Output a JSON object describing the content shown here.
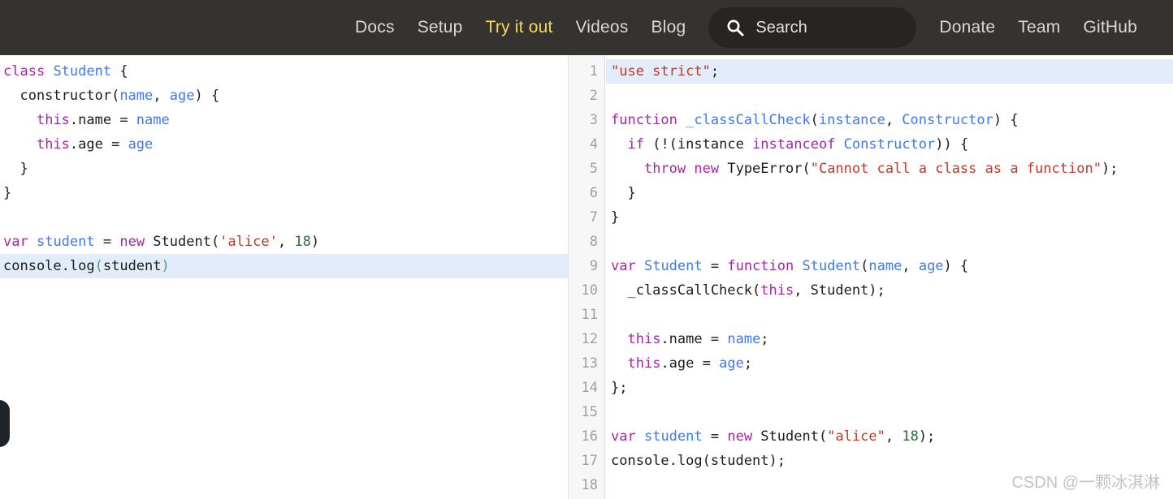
{
  "navbar": {
    "items": [
      {
        "label": "Docs",
        "active": false
      },
      {
        "label": "Setup",
        "active": false
      },
      {
        "label": "Try it out",
        "active": true
      },
      {
        "label": "Videos",
        "active": false
      },
      {
        "label": "Blog",
        "active": false
      }
    ],
    "right_items": [
      {
        "label": "Donate"
      },
      {
        "label": "Team"
      },
      {
        "label": "GitHub"
      }
    ],
    "search": {
      "placeholder": "Search",
      "icon": "search-icon"
    },
    "colors": {
      "background": "#34332f",
      "link": "#d8d8d4",
      "active_link": "#f5da55",
      "search_background": "#262523"
    }
  },
  "editor": {
    "input": {
      "active_line_index": 8,
      "lines": [
        {
          "tokens": [
            {
              "t": "class",
              "c": "t-kw"
            },
            {
              "t": " ",
              "c": "t-plain"
            },
            {
              "t": "Student",
              "c": "t-def"
            },
            {
              "t": " {",
              "c": "t-plain"
            }
          ]
        },
        {
          "tokens": [
            {
              "t": "  constructor",
              "c": "t-plain"
            },
            {
              "t": "(",
              "c": "t-plain"
            },
            {
              "t": "name",
              "c": "t-var"
            },
            {
              "t": ", ",
              "c": "t-plain"
            },
            {
              "t": "age",
              "c": "t-var"
            },
            {
              "t": ") {",
              "c": "t-plain"
            }
          ]
        },
        {
          "tokens": [
            {
              "t": "    ",
              "c": "t-plain"
            },
            {
              "t": "this",
              "c": "t-atom"
            },
            {
              "t": ".name = ",
              "c": "t-plain"
            },
            {
              "t": "name",
              "c": "t-var"
            }
          ]
        },
        {
          "tokens": [
            {
              "t": "    ",
              "c": "t-plain"
            },
            {
              "t": "this",
              "c": "t-atom"
            },
            {
              "t": ".age = ",
              "c": "t-plain"
            },
            {
              "t": "age",
              "c": "t-var"
            }
          ]
        },
        {
          "tokens": [
            {
              "t": "  }",
              "c": "t-plain"
            }
          ]
        },
        {
          "tokens": [
            {
              "t": "}",
              "c": "t-plain"
            }
          ]
        },
        {
          "tokens": [
            {
              "t": "",
              "c": "t-plain"
            }
          ]
        },
        {
          "tokens": [
            {
              "t": "var",
              "c": "t-kw"
            },
            {
              "t": " ",
              "c": "t-plain"
            },
            {
              "t": "student",
              "c": "t-def"
            },
            {
              "t": " = ",
              "c": "t-plain"
            },
            {
              "t": "new",
              "c": "t-kw"
            },
            {
              "t": " Student(",
              "c": "t-plain"
            },
            {
              "t": "'alice'",
              "c": "t-str"
            },
            {
              "t": ", ",
              "c": "t-plain"
            },
            {
              "t": "18",
              "c": "t-num"
            },
            {
              "t": ")",
              "c": "t-plain"
            }
          ]
        },
        {
          "tokens": [
            {
              "t": "console.",
              "c": "t-plain"
            },
            {
              "t": "log",
              "c": "t-plain"
            },
            {
              "t": "(",
              "c": "t-paren-g"
            },
            {
              "t": "student",
              "c": "t-plain"
            },
            {
              "t": ")",
              "c": "t-paren-g"
            }
          ]
        }
      ]
    },
    "output": {
      "active_line_index": 0,
      "line_numbers": [
        "1",
        "2",
        "3",
        "4",
        "5",
        "6",
        "7",
        "8",
        "9",
        "10",
        "11",
        "12",
        "13",
        "14",
        "15",
        "16",
        "17",
        "18"
      ],
      "lines": [
        {
          "tokens": [
            {
              "t": "\"use strict\"",
              "c": "t-str"
            },
            {
              "t": ";",
              "c": "t-plain"
            }
          ]
        },
        {
          "tokens": [
            {
              "t": "",
              "c": "t-plain"
            }
          ]
        },
        {
          "tokens": [
            {
              "t": "function",
              "c": "t-kw"
            },
            {
              "t": " ",
              "c": "t-plain"
            },
            {
              "t": "_classCallCheck",
              "c": "t-def"
            },
            {
              "t": "(",
              "c": "t-plain"
            },
            {
              "t": "instance",
              "c": "t-var"
            },
            {
              "t": ", ",
              "c": "t-plain"
            },
            {
              "t": "Constructor",
              "c": "t-var"
            },
            {
              "t": ") {",
              "c": "t-plain"
            }
          ]
        },
        {
          "tokens": [
            {
              "t": "  ",
              "c": "t-plain"
            },
            {
              "t": "if",
              "c": "t-kw"
            },
            {
              "t": " (!(",
              "c": "t-plain"
            },
            {
              "t": "instance",
              "c": "t-plain"
            },
            {
              "t": " ",
              "c": "t-plain"
            },
            {
              "t": "instanceof",
              "c": "t-kw"
            },
            {
              "t": " ",
              "c": "t-plain"
            },
            {
              "t": "Constructor",
              "c": "t-var"
            },
            {
              "t": ")) {",
              "c": "t-plain"
            }
          ]
        },
        {
          "tokens": [
            {
              "t": "    ",
              "c": "t-plain"
            },
            {
              "t": "throw",
              "c": "t-kw"
            },
            {
              "t": " ",
              "c": "t-plain"
            },
            {
              "t": "new",
              "c": "t-kw"
            },
            {
              "t": " TypeError(",
              "c": "t-plain"
            },
            {
              "t": "\"Cannot call a class as a function\"",
              "c": "t-str"
            },
            {
              "t": ");",
              "c": "t-plain"
            }
          ]
        },
        {
          "tokens": [
            {
              "t": "  }",
              "c": "t-plain"
            }
          ]
        },
        {
          "tokens": [
            {
              "t": "}",
              "c": "t-plain"
            }
          ]
        },
        {
          "tokens": [
            {
              "t": "",
              "c": "t-plain"
            }
          ]
        },
        {
          "tokens": [
            {
              "t": "var",
              "c": "t-kw"
            },
            {
              "t": " ",
              "c": "t-plain"
            },
            {
              "t": "Student",
              "c": "t-def"
            },
            {
              "t": " = ",
              "c": "t-plain"
            },
            {
              "t": "function",
              "c": "t-kw"
            },
            {
              "t": " ",
              "c": "t-plain"
            },
            {
              "t": "Student",
              "c": "t-def"
            },
            {
              "t": "(",
              "c": "t-plain"
            },
            {
              "t": "name",
              "c": "t-var"
            },
            {
              "t": ", ",
              "c": "t-plain"
            },
            {
              "t": "age",
              "c": "t-var"
            },
            {
              "t": ") {",
              "c": "t-plain"
            }
          ]
        },
        {
          "tokens": [
            {
              "t": "  _classCallCheck(",
              "c": "t-plain"
            },
            {
              "t": "this",
              "c": "t-atom"
            },
            {
              "t": ", Student);",
              "c": "t-plain"
            }
          ]
        },
        {
          "tokens": [
            {
              "t": "",
              "c": "t-plain"
            }
          ]
        },
        {
          "tokens": [
            {
              "t": "  ",
              "c": "t-plain"
            },
            {
              "t": "this",
              "c": "t-atom"
            },
            {
              "t": ".name = ",
              "c": "t-plain"
            },
            {
              "t": "name",
              "c": "t-var"
            },
            {
              "t": ";",
              "c": "t-plain"
            }
          ]
        },
        {
          "tokens": [
            {
              "t": "  ",
              "c": "t-plain"
            },
            {
              "t": "this",
              "c": "t-atom"
            },
            {
              "t": ".age = ",
              "c": "t-plain"
            },
            {
              "t": "age",
              "c": "t-var"
            },
            {
              "t": ";",
              "c": "t-plain"
            }
          ]
        },
        {
          "tokens": [
            {
              "t": "};",
              "c": "t-plain"
            }
          ]
        },
        {
          "tokens": [
            {
              "t": "",
              "c": "t-plain"
            }
          ]
        },
        {
          "tokens": [
            {
              "t": "var",
              "c": "t-kw"
            },
            {
              "t": " ",
              "c": "t-plain"
            },
            {
              "t": "student",
              "c": "t-def"
            },
            {
              "t": " = ",
              "c": "t-plain"
            },
            {
              "t": "new",
              "c": "t-kw"
            },
            {
              "t": " Student(",
              "c": "t-plain"
            },
            {
              "t": "\"alice\"",
              "c": "t-str"
            },
            {
              "t": ", ",
              "c": "t-plain"
            },
            {
              "t": "18",
              "c": "t-num"
            },
            {
              "t": ");",
              "c": "t-plain"
            }
          ]
        },
        {
          "tokens": [
            {
              "t": "console.log(student);",
              "c": "t-plain"
            }
          ]
        },
        {
          "tokens": [
            {
              "t": "",
              "c": "t-plain"
            }
          ]
        }
      ]
    }
  },
  "panel_handle": {
    "name": "collapse-panel-handle"
  },
  "watermark": {
    "text": "CSDN @一颗冰淇淋"
  }
}
